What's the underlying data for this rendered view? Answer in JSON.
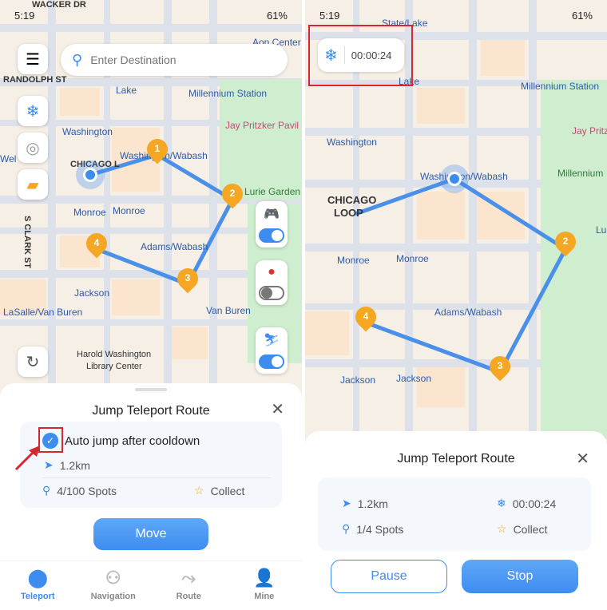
{
  "status_bar": {
    "time": "5:19",
    "battery": "61%"
  },
  "left": {
    "search_placeholder": "Enter Destination",
    "map_labels": [
      "WACKER DR",
      "RANDOLPH ST",
      "Lake",
      "Millennium Station",
      "Jay Pritzker Pavil",
      "Washington",
      "Washington/Wabash",
      "CHICAGO L",
      "Lurie Garden",
      "Monroe",
      "Monroe",
      "S CLARK ST",
      "Adams/Wabash",
      "Jackson",
      "LaSalle/Van Buren",
      "Harold Washington",
      "Library Center",
      "Van Buren",
      "Aon Center",
      "Wel"
    ],
    "pins": [
      "1",
      "2",
      "3",
      "4"
    ],
    "sheet": {
      "title": "Jump Teleport Route",
      "auto_jump_label": "Auto jump after cooldown",
      "auto_jump_checked": true,
      "distance": "1.2km",
      "spots": "4/100 Spots",
      "collect": "Collect",
      "move_button": "Move"
    },
    "tabs": [
      {
        "label": "Teleport",
        "active": true
      },
      {
        "label": "Navigation"
      },
      {
        "label": "Route"
      },
      {
        "label": "Mine"
      }
    ]
  },
  "right": {
    "cooldown_timer": "00:00:24",
    "map_labels": [
      "State/Lake",
      "Lake",
      "Millennium Station",
      "Jay Pritz",
      "Washington",
      "Washington/Wabash",
      "CHICAGO",
      "LOOP",
      "Millennium",
      "Monroe",
      "Monroe",
      "Adams/Wabash",
      "Jackson",
      "Jackson",
      "Lu"
    ],
    "pins": [
      "2",
      "3",
      "4"
    ],
    "sheet": {
      "title": "Jump Teleport Route",
      "distance": "1.2km",
      "timer": "00:00:24",
      "spots": "1/4 Spots",
      "collect": "Collect",
      "pause_button": "Pause",
      "stop_button": "Stop"
    }
  },
  "colors": {
    "accent": "#3d8cf0",
    "pin": "#f5a623",
    "highlight": "#d7262e"
  }
}
